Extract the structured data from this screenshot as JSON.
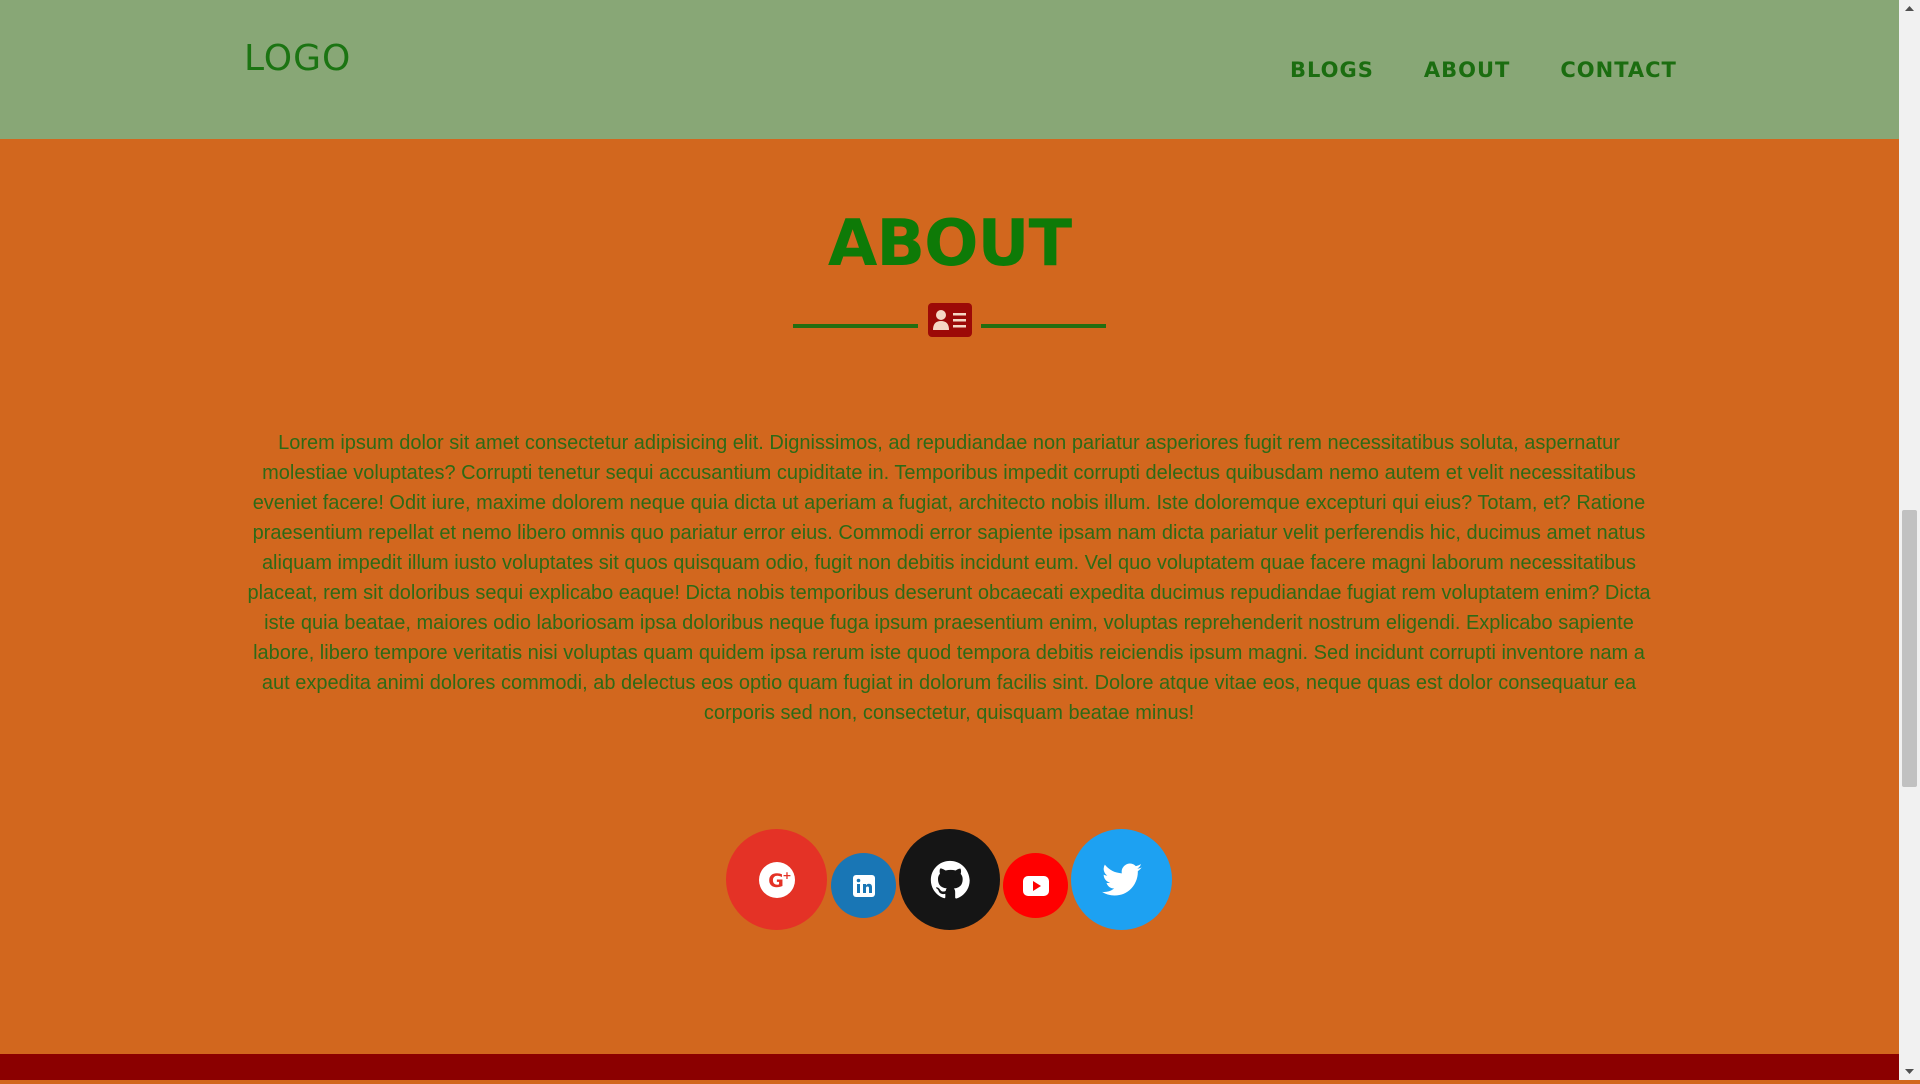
{
  "header": {
    "logo": "LOGO",
    "nav": [
      "BLOGS",
      "ABOUT",
      "CONTACT"
    ]
  },
  "about": {
    "title": "ABOUT",
    "divider_icon": "id-card-icon",
    "text": "Lorem ipsum dolor sit amet consectetur adipisicing elit. Dignissimos, ad repudiandae non pariatur asperiores fugit rem necessitatibus soluta, aspernatur molestiae voluptates? Corrupti tenetur sequi accusantium cupiditate in. Temporibus impedit corrupti delectus quibusdam nemo autem et velit necessitatibus eveniet facere! Odit iure, maxime dolorem neque quia dicta ut aperiam a fugiat, architecto nobis illum. Iste doloremque excepturi qui eius? Totam, et? Ratione praesentium repellat et nemo libero omnis quo pariatur error eius. Commodi error sapiente ipsam nam dicta pariatur velit perferendis hic, ducimus amet natus aliquam impedit illum iusto voluptates sit quos quisquam odio, fugit non debitis incidunt eum. Vel quo voluptatem quae facere magni laborum necessitatibus placeat, rem sit doloribus sequi explicabo eaque! Dicta nobis temporibus deserunt obcaecati expedita ducimus repudiandae fugiat rem voluptatem enim? Dicta iste quia beatae, maiores odio laboriosam ipsa doloribus neque fuga ipsum praesentium enim, voluptas reprehenderit nostrum eligendi. Explicabo sapiente labore, libero tempore veritatis nisi voluptas quam quidem ipsa rerum iste quod tempora debitis reiciendis ipsum magni. Sed incidunt corrupti inventore nam a aut expedita animi dolores commodi, ab delectus eos optio quam fugiat in dolorum facilis sint. Dolore atque vitae eos, neque quas est dolor consequatur ea corporis sed non, consectetur, quisquam beatae minus!"
  },
  "social": [
    {
      "icon": "google-plus-icon",
      "color": "#e43226"
    },
    {
      "icon": "linkedin-icon",
      "color": "#1976b5"
    },
    {
      "icon": "github-icon",
      "color": "#151515"
    },
    {
      "icon": "youtube-icon",
      "color": "#ff0000"
    },
    {
      "icon": "twitter-icon",
      "color": "#1da1f2"
    }
  ],
  "colors": {
    "header_bg": "#88a776",
    "page_bg": "#d2671e",
    "title": "#0e7a07",
    "footer": "#8b0000"
  }
}
